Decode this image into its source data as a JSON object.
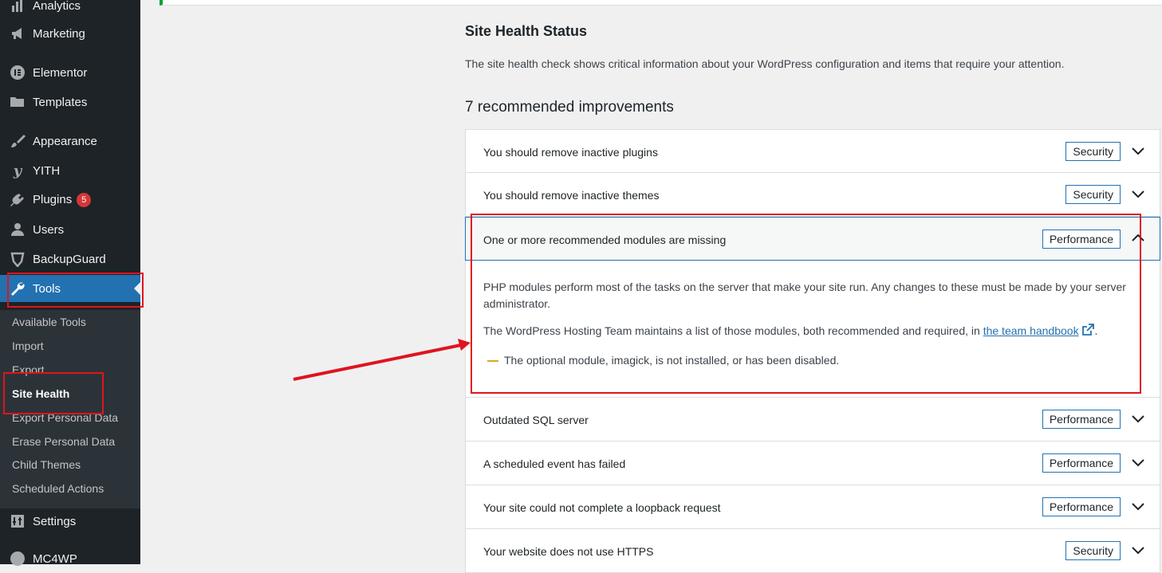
{
  "sidebar": {
    "menu": [
      {
        "id": "analytics",
        "label": "Analytics"
      },
      {
        "id": "marketing",
        "label": "Marketing"
      },
      {
        "id": "elementor",
        "label": "Elementor"
      },
      {
        "id": "templates",
        "label": "Templates"
      },
      {
        "id": "appearance",
        "label": "Appearance"
      },
      {
        "id": "yith",
        "label": "YITH"
      },
      {
        "id": "plugins",
        "label": "Plugins",
        "badge": "5"
      },
      {
        "id": "users",
        "label": "Users"
      },
      {
        "id": "backupguard",
        "label": "BackupGuard"
      },
      {
        "id": "tools",
        "label": "Tools"
      },
      {
        "id": "settings",
        "label": "Settings"
      },
      {
        "id": "mc4wp",
        "label": "MC4WP"
      }
    ],
    "submenu": [
      "Available Tools",
      "Import",
      "Export",
      "Site Health",
      "Export Personal Data",
      "Erase Personal Data",
      "Child Themes",
      "Scheduled Actions"
    ]
  },
  "main": {
    "title": "Site Health Status",
    "description": "The site health check shows critical information about your WordPress configuration and items that require your attention.",
    "improvements_heading": "7 recommended improvements",
    "items": [
      {
        "title": "You should remove inactive plugins",
        "tag": "Security"
      },
      {
        "title": "You should remove inactive themes",
        "tag": "Security"
      },
      {
        "title": "One or more recommended modules are missing",
        "tag": "Performance"
      },
      {
        "title": "Outdated SQL server",
        "tag": "Performance"
      },
      {
        "title": "A scheduled event has failed",
        "tag": "Performance"
      },
      {
        "title": "Your site could not complete a loopback request",
        "tag": "Performance"
      },
      {
        "title": "Your website does not use HTTPS",
        "tag": "Security"
      }
    ],
    "panel": {
      "paragraph1": "PHP modules perform most of the tasks on the server that make your site run. Any changes to these must be made by your server administrator.",
      "paragraph2_prefix": "The WordPress Hosting Team maintains a list of those modules, both recommended and required, in",
      "paragraph2_link": "the team handbook",
      "paragraph2_suffix": ".",
      "warning": "The optional module, imagick, is not installed, or has been disabled."
    }
  },
  "colors": {
    "accent": "#2271b1",
    "annotation": "#e0141e",
    "warning": "#dba617",
    "success": "#00a32a"
  }
}
